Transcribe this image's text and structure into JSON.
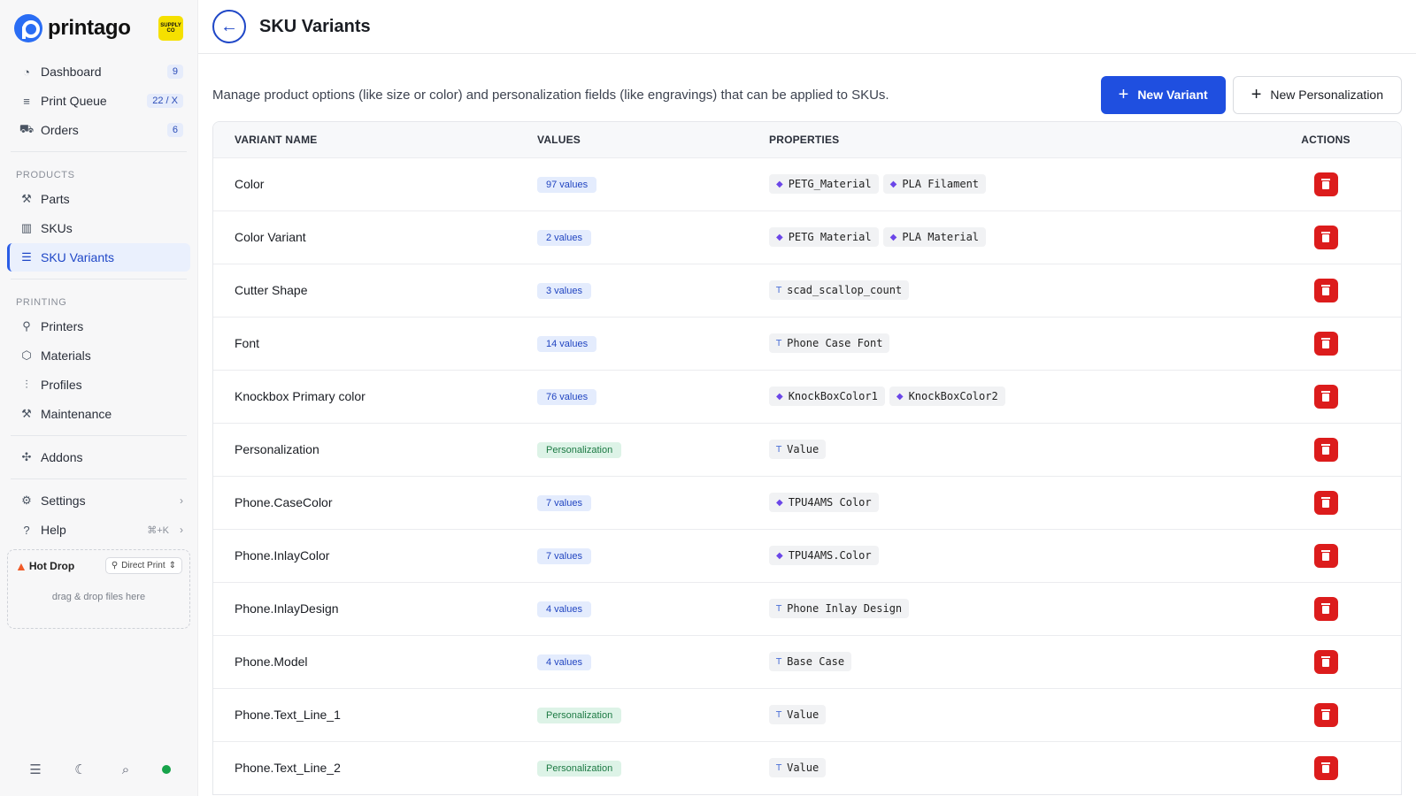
{
  "brand": {
    "name": "printago",
    "org_badge": "SUPPLY CO"
  },
  "nav": {
    "main": [
      {
        "label": "Dashboard",
        "icon": "dashboard-icon",
        "count": "9"
      },
      {
        "label": "Print Queue",
        "icon": "queue-icon",
        "count": "22 / X"
      },
      {
        "label": "Orders",
        "icon": "cart-icon",
        "count": "6"
      }
    ],
    "products_label": "PRODUCTS",
    "products": [
      {
        "label": "Parts",
        "icon": "parts-icon"
      },
      {
        "label": "SKUs",
        "icon": "barcode-icon"
      },
      {
        "label": "SKU Variants",
        "icon": "list-icon",
        "active": true
      }
    ],
    "printing_label": "PRINTING",
    "printing": [
      {
        "label": "Printers",
        "icon": "printer-icon"
      },
      {
        "label": "Materials",
        "icon": "materials-icon"
      },
      {
        "label": "Profiles",
        "icon": "sliders-icon"
      },
      {
        "label": "Maintenance",
        "icon": "wrench-icon"
      }
    ],
    "addons": "Addons",
    "settings": "Settings",
    "help": "Help",
    "help_shortcut": "⌘+K"
  },
  "hotdrop": {
    "title": "Hot Drop",
    "mode": "Direct Print",
    "hint": "drag & drop files here"
  },
  "header": {
    "title": "SKU Variants"
  },
  "toolbar": {
    "description": "Manage product options (like size or color) and personalization fields (like engravings) that can be applied to SKUs.",
    "new_variant": "New Variant",
    "new_personalization": "New Personalization"
  },
  "table": {
    "columns": [
      "VARIANT NAME",
      "VALUES",
      "PROPERTIES",
      "ACTIONS"
    ],
    "rows": [
      {
        "name": "Color",
        "values": "97 values",
        "type": "values",
        "props": [
          {
            "kind": "material",
            "label": "PETG_Material"
          },
          {
            "kind": "material",
            "label": "PLA Filament"
          }
        ]
      },
      {
        "name": "Color Variant",
        "values": "2 values",
        "type": "values",
        "props": [
          {
            "kind": "material",
            "label": "PETG Material"
          },
          {
            "kind": "material",
            "label": "PLA Material"
          }
        ]
      },
      {
        "name": "Cutter Shape",
        "values": "3 values",
        "type": "values",
        "props": [
          {
            "kind": "text",
            "label": "scad_scallop_count"
          }
        ]
      },
      {
        "name": "Font",
        "values": "14 values",
        "type": "values",
        "props": [
          {
            "kind": "text",
            "label": "Phone Case Font"
          }
        ]
      },
      {
        "name": "Knockbox Primary color",
        "values": "76 values",
        "type": "values",
        "props": [
          {
            "kind": "material",
            "label": "KnockBoxColor1"
          },
          {
            "kind": "material",
            "label": "KnockBoxColor2"
          }
        ]
      },
      {
        "name": "Personalization",
        "values": "Personalization",
        "type": "perso",
        "props": [
          {
            "kind": "text",
            "label": "Value"
          }
        ]
      },
      {
        "name": "Phone.CaseColor",
        "values": "7 values",
        "type": "values",
        "props": [
          {
            "kind": "material",
            "label": "TPU4AMS Color"
          }
        ]
      },
      {
        "name": "Phone.InlayColor",
        "values": "7 values",
        "type": "values",
        "props": [
          {
            "kind": "material",
            "label": "TPU4AMS.Color"
          }
        ]
      },
      {
        "name": "Phone.InlayDesign",
        "values": "4 values",
        "type": "values",
        "props": [
          {
            "kind": "text",
            "label": "Phone Inlay Design"
          }
        ]
      },
      {
        "name": "Phone.Model",
        "values": "4 values",
        "type": "values",
        "props": [
          {
            "kind": "text",
            "label": "Base Case"
          }
        ]
      },
      {
        "name": "Phone.Text_Line_1",
        "values": "Personalization",
        "type": "perso",
        "props": [
          {
            "kind": "text",
            "label": "Value"
          }
        ]
      },
      {
        "name": "Phone.Text_Line_2",
        "values": "Personalization",
        "type": "perso",
        "props": [
          {
            "kind": "text",
            "label": "Value"
          }
        ]
      }
    ]
  },
  "colors": {
    "accent": "#1f4fe0",
    "danger": "#dc1c1c",
    "status_online": "#16a34a"
  }
}
